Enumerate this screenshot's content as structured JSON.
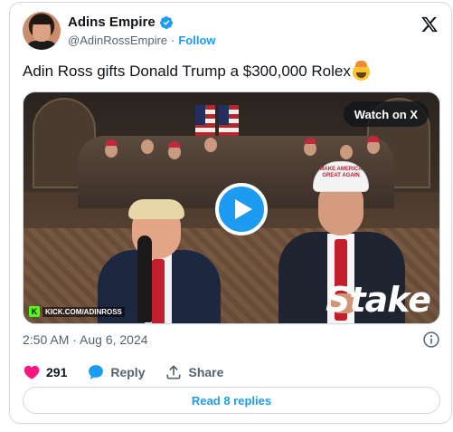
{
  "author": {
    "name": "Adins Empire",
    "handle": "@AdinRossEmpire",
    "separator": "·",
    "follow_label": "Follow"
  },
  "tweet": {
    "text": "Adin Ross gifts Donald Trump a $300,000 Rolex",
    "emoji": "exploding-head-emoji"
  },
  "media": {
    "watch_label": "Watch on X",
    "kick_badge": "K",
    "kick_url": "KICK.COM/ADINROSS",
    "watermark": "Stake",
    "cap_text": "MAKE AMERICA GREAT AGAIN"
  },
  "timestamp": "2:50 AM · Aug 6, 2024",
  "actions": {
    "like_count": "291",
    "reply_label": "Reply",
    "share_label": "Share"
  },
  "replies_button": "Read 8 replies",
  "colors": {
    "accent": "#1d9bf0",
    "like": "#f91880",
    "muted": "#536471",
    "text": "#0f1419",
    "border": "#cfd9de"
  },
  "icons": [
    "verified-badge-icon",
    "x-logo-icon",
    "play-icon",
    "info-icon",
    "heart-icon",
    "reply-bubble-icon",
    "share-icon"
  ]
}
